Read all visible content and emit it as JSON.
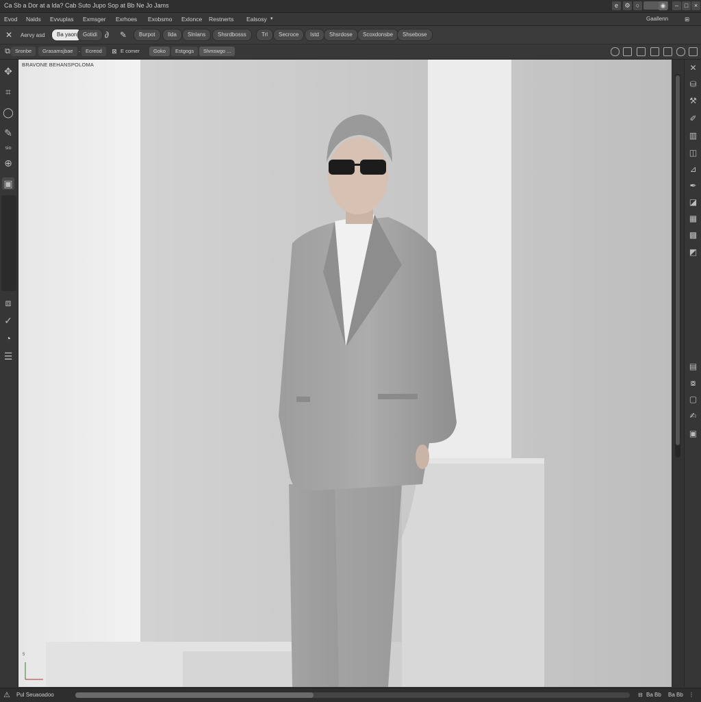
{
  "titlebar": {
    "title": "Ca  Sb a Dor at a lda?  Cab  Suto  Jupo    Sop at  Bb  Ne  Jo Jams"
  },
  "menubar": {
    "items": [
      "Evod",
      "Nalds",
      "Evvuplas",
      "Exmsger",
      "Exrhoes",
      "Exobsmo",
      "Exlonce",
      "Restnerts",
      "Ealsosy"
    ],
    "right_label": "Gaallenn"
  },
  "toolbar1": {
    "left_label": "Aervy asd",
    "pills": [
      "Ba yaon",
      "Gotidi",
      "Burpot",
      "Ilda",
      "Slnlans",
      "Shsrdbosss",
      "Secroce",
      "Istd",
      "Shsrdose",
      "Scoxdonsbe",
      "Shsebose"
    ]
  },
  "toolbar2": {
    "items": [
      "Sronbe",
      "Grasamsjbae",
      "Ecreod",
      "E comer",
      "Goko",
      "Estgogs",
      "Slvnswgo ..."
    ]
  },
  "canvas": {
    "layer_name": "BRAVONE BEHANSPOLOMA"
  },
  "statusbar": {
    "left_text": "Pul Seuaoadoo",
    "progress": 0.43,
    "right_items": [
      "Ba Bb",
      "Ba Bb"
    ]
  },
  "colors": {
    "ui_dark": "#3a3a3a",
    "canvas_bg": "#cfcfcf",
    "accent": "#e8e8e8"
  }
}
